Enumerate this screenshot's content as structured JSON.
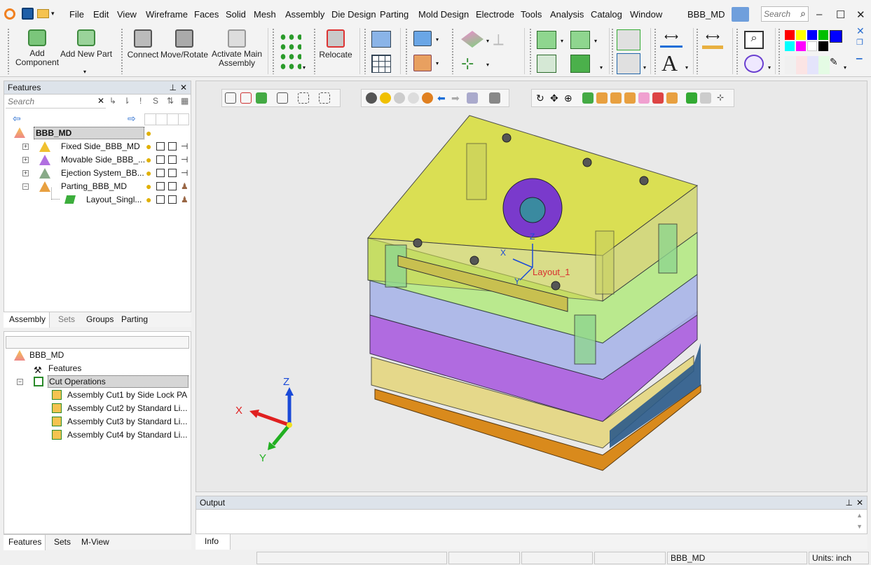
{
  "titlebar": {
    "menus": [
      "File",
      "Edit",
      "View",
      "Wireframe",
      "Faces",
      "Solid",
      "Mesh",
      "Assembly",
      "Die Design",
      "Parting",
      "Mold Design",
      "Electrode",
      "Tools",
      "Analysis",
      "Catalog",
      "Window"
    ],
    "doc_title": "BBB_MD",
    "search_placeholder": "Search",
    "minimize": "–",
    "maximize": "☐",
    "close": "✕"
  },
  "toolbar": {
    "add_component": "Add Component",
    "add_new_part": "Add New Part",
    "connect": "Connect",
    "move_rotate": "Move/Rotate",
    "activate_main_assembly": "Activate Main Assembly",
    "relocate": "Relocate"
  },
  "palette_colors": [
    "#ff0000",
    "#ffff00",
    "#0000ff",
    "#00c000",
    "#0000ff",
    "#00ffff",
    "#ff00ff",
    "#ffffff",
    "#000000"
  ],
  "features_panel": {
    "title": "Features",
    "search_placeholder": "Search",
    "tree": [
      {
        "label": "BBB_MD",
        "level": 0,
        "expander": ""
      },
      {
        "label": "Fixed Side_BBB_MD",
        "level": 1,
        "expander": "+"
      },
      {
        "label": "Movable Side_BBB_...",
        "level": 1,
        "expander": "+"
      },
      {
        "label": "Ejection System_BB...",
        "level": 1,
        "expander": "+"
      },
      {
        "label": "Parting_BBB_MD",
        "level": 1,
        "expander": "−"
      },
      {
        "label": "Layout_Singl...",
        "level": 2,
        "expander": ""
      }
    ],
    "tabs": [
      "Assembly",
      "Sets",
      "Groups",
      "Parting"
    ]
  },
  "lower_panel": {
    "tree": [
      {
        "label": "BBB_MD",
        "level": 0
      },
      {
        "label": "Features",
        "level": 1
      },
      {
        "label": "Cut Operations",
        "level": 1
      },
      {
        "label": "Assembly Cut1 by Side Lock PA",
        "level": 2
      },
      {
        "label": "Assembly Cut2 by Standard Li...",
        "level": 2
      },
      {
        "label": "Assembly Cut3 by Standard Li...",
        "level": 2
      },
      {
        "label": "Assembly Cut4 by Standard Li...",
        "level": 2
      }
    ],
    "tabs": [
      "Features",
      "Sets",
      "M-View"
    ]
  },
  "viewport": {
    "layout_label": "Layout_1",
    "local_axes": {
      "x": "X",
      "y": "Y",
      "z": "Z"
    },
    "triad": {
      "x": "X",
      "y": "Y",
      "z": "Z"
    }
  },
  "output_panel": {
    "title": "Output",
    "tab": "Info"
  },
  "statusbar": {
    "doc": "BBB_MD",
    "units": "Units: inch"
  }
}
